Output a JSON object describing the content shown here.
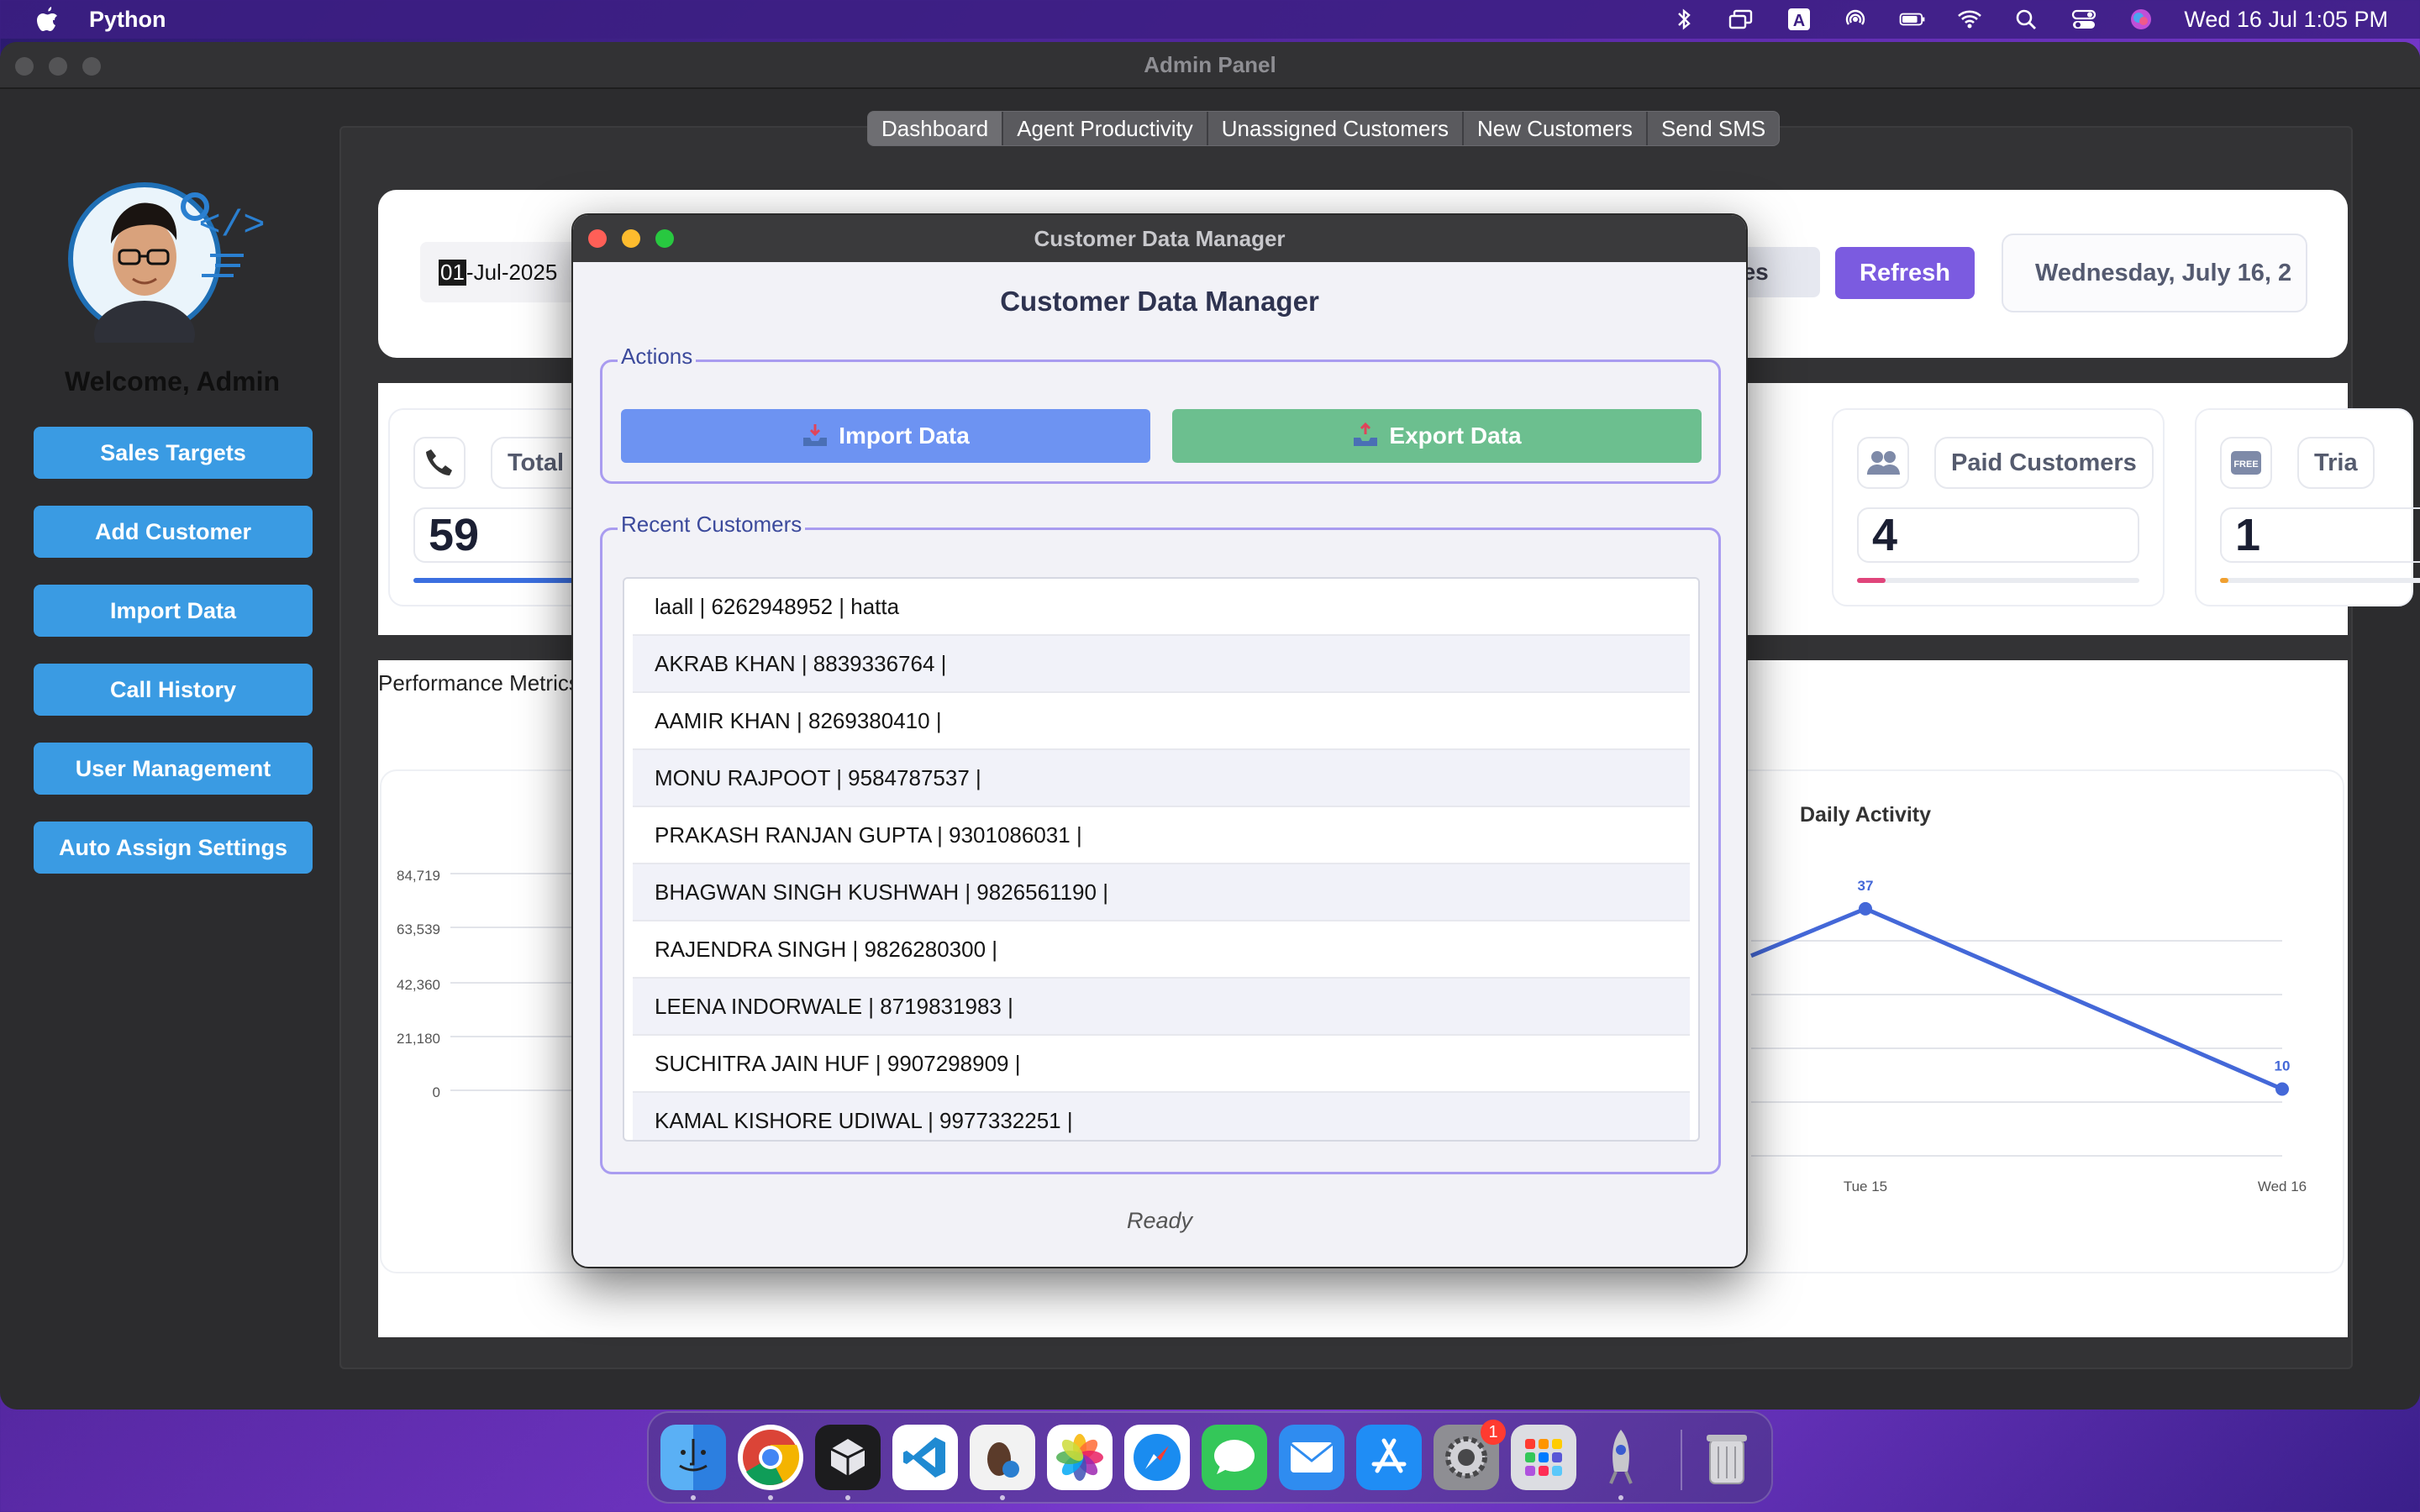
{
  "menubar": {
    "app_name": "Python",
    "datetime": "Wed 16 Jul  1:05 PM"
  },
  "window": {
    "title": "Admin Panel"
  },
  "sidebar": {
    "welcome": "Welcome, Admin",
    "buttons": [
      "Sales Targets",
      "Add Customer",
      "Import Data",
      "Call History",
      "User Management",
      "Auto Assign Settings"
    ]
  },
  "tabs": [
    "Dashboard",
    "Agent Productivity",
    "Unassigned Customers",
    "New Customers",
    "Send SMS"
  ],
  "filters": {
    "date_prefix_selected": "01",
    "date_rest": "-Jul-2025",
    "partial_button": "ees",
    "refresh_label": "Refresh",
    "current_date": "Wednesday, July 16, 2"
  },
  "stats": [
    {
      "title": "Total C",
      "value": "59",
      "icon": "phone-icon",
      "bar_color": "#3b6fe0",
      "fill": 1.0
    },
    {
      "title": "Paid Customers",
      "value": "4",
      "icon": "users-icon",
      "bar_color": "#e0457b",
      "fill": 0.1
    },
    {
      "title": "Tria",
      "value": "1",
      "icon": "free-icon",
      "bar_color": "#f0a030",
      "fill": 0.03
    }
  ],
  "performance": {
    "label": "Performance Metrics"
  },
  "chart_data": {
    "type": "line",
    "title": "Daily Activity",
    "visible_left_axis_ticks": [
      "0",
      "21,180",
      "42,360",
      "63,539",
      "84,719"
    ],
    "x": [
      "Tue 15",
      "Wed 16"
    ],
    "series": [
      {
        "values": [
          37,
          10
        ]
      }
    ],
    "data_labels": [
      "37",
      "10"
    ],
    "grid": true
  },
  "dialog": {
    "title": "Customer Data Manager",
    "heading": "Customer Data Manager",
    "actions_legend": "Actions",
    "import_label": "Import Data",
    "export_label": "Export Data",
    "recent_legend": "Recent Customers",
    "customers": [
      "laall | 6262948952 | hatta",
      "AKRAB KHAN | 8839336764 |",
      "AAMIR KHAN | 8269380410 |",
      "MONU RAJPOOT | 9584787537 |",
      "PRAKASH RANJAN GUPTA | 9301086031 |",
      "BHAGWAN SINGH KUSHWAH | 9826561190 |",
      "RAJENDRA SINGH | 9826280300 |",
      "LEENA INDORWALE | 8719831983 |",
      "SUCHITRA JAIN HUF | 9907298909 |",
      "KAMAL KISHORE UDIWAL | 9977332251 |"
    ],
    "status": "Ready"
  },
  "dock": {
    "apps": [
      "finder",
      "chrome",
      "app-3",
      "vscode",
      "app-5",
      "photos",
      "safari",
      "messages",
      "mail",
      "app-store",
      "system-settings",
      "launchpad",
      "app-13",
      "trash"
    ],
    "settings_badge": "1"
  },
  "colors": {
    "sidebar_button": "#3a9be3",
    "refresh": "#7b5be0",
    "import": "#6d93f2",
    "export": "#6cbf8f",
    "chart_line": "#4468d8"
  }
}
